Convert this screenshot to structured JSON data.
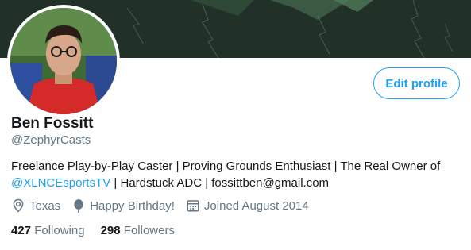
{
  "profile": {
    "name": "Ben Fossitt",
    "handle": "@ZephyrCasts",
    "edit_label": "Edit profile",
    "bio": {
      "text_part1": "Freelance Play-by-Play Caster | Proving Grounds Enthusiast |  The Real Owner of",
      "link": "@XLNCEsportsTV",
      "text_part2": " | Hardstuck ADC | fossittben@gmail.com"
    },
    "location": "Texas",
    "birthday": "Happy Birthday!",
    "joined": "Joined August 2014",
    "following_count": "427",
    "following_label": "Following",
    "followers_count": "298",
    "followers_label": "Followers"
  },
  "icons": {
    "location": "location-pin-icon",
    "birthday": "balloon-icon",
    "joined": "calendar-icon"
  },
  "colors": {
    "accent": "#1da1f2",
    "secondary_text": "#657786",
    "primary_text": "#14171a"
  }
}
